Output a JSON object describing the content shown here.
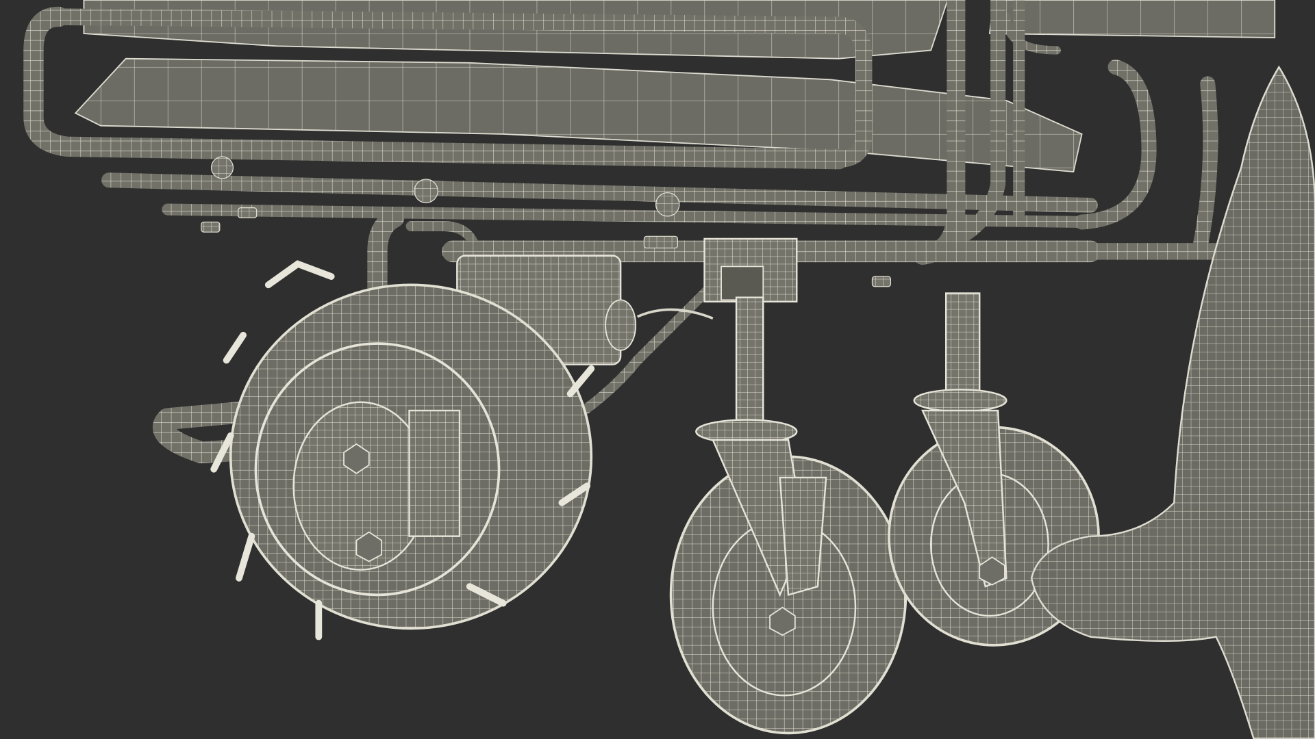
{
  "scene": {
    "subject": "wireframe-render-vehicle-undercarriage",
    "colors": {
      "background": "#2f2f2f",
      "surface": "#6f6e66",
      "surface_dark": "#57564f",
      "wire": "#e4e2d6",
      "shadow": "#3d3c38"
    }
  }
}
